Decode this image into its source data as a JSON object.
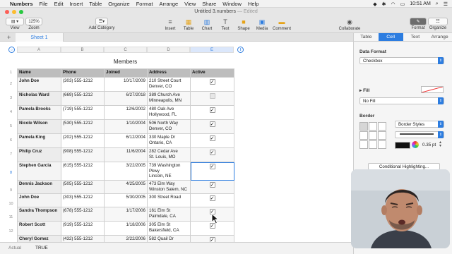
{
  "menubar": {
    "app_name": "Numbers",
    "items": [
      "File",
      "Edit",
      "Insert",
      "Table",
      "Organize",
      "Format",
      "Arrange",
      "View",
      "Share",
      "Window",
      "Help"
    ],
    "clock": "10:51 AM"
  },
  "window": {
    "title": "Untitled 3.numbers",
    "edited": "— Edited"
  },
  "toolbar": {
    "view": "View",
    "zoom_value": "125%",
    "zoom": "Zoom",
    "add_category": "Add Category",
    "insert": "Insert",
    "table": "Table",
    "chart": "Chart",
    "text": "Text",
    "shape": "Shape",
    "media": "Media",
    "comment": "Comment",
    "collaborate": "Collaborate",
    "format": "Format",
    "organize": "Organize"
  },
  "sheet": {
    "tab": "Sheet 1"
  },
  "columns": [
    "A",
    "B",
    "C",
    "D",
    "E"
  ],
  "table": {
    "title": "Members",
    "headers": [
      "Name",
      "Phone",
      "Joined",
      "Address",
      "Active"
    ],
    "rows": [
      {
        "name": "John Doe",
        "phone": "(303) 555-1212",
        "joined": "10/17/2009",
        "addr1": "210 Street Court",
        "addr2": "Denver, CO",
        "addr3": "",
        "active": true
      },
      {
        "name": "Nicholas Ward",
        "phone": "(669) 555-1212",
        "joined": "6/27/2018",
        "addr1": "389 Church Ave",
        "addr2": "Minneapolis, MN",
        "addr3": "",
        "active": false
      },
      {
        "name": "Pamela Brooks",
        "phone": "(719) 555-1212",
        "joined": "12/6/2002",
        "addr1": "480 Oak Ave",
        "addr2": "Hollywood, FL",
        "addr3": "",
        "active": true
      },
      {
        "name": "Nicole Wilson",
        "phone": "(530) 555-1212",
        "joined": "1/10/2004",
        "addr1": "506 North Way",
        "addr2": "Denver, CO",
        "addr3": "",
        "active": true
      },
      {
        "name": "Pamela King",
        "phone": "(202) 555-1212",
        "joined": "6/12/2004",
        "addr1": "330 Maple Dr",
        "addr2": "Ontario, CA",
        "addr3": "",
        "active": true
      },
      {
        "name": "Philip Cruz",
        "phone": "(908) 555-1212",
        "joined": "11/6/2004",
        "addr1": "282 Cedar Ave",
        "addr2": "St. Louis, MO",
        "addr3": "",
        "active": true
      },
      {
        "name": "Stephen Garcia",
        "phone": "(615) 555-1212",
        "joined": "3/22/2005",
        "addr1": "739 Washington",
        "addr2": "Pkwy",
        "addr3": "Lincoln, NE",
        "active": true
      },
      {
        "name": "Dennis Jackson",
        "phone": "(505) 555-1212",
        "joined": "4/25/2005",
        "addr1": "473 Elm Way",
        "addr2": "Winston Salem, NC",
        "addr3": "",
        "active": true
      },
      {
        "name": "John Doe",
        "phone": "(303) 555-1212",
        "joined": "5/30/2005",
        "addr1": "300 Street Road",
        "addr2": "",
        "addr3": "",
        "active": true
      },
      {
        "name": "Sandra Thompson",
        "phone": "(678) 555-1212",
        "joined": "1/17/2006",
        "addr1": "161 Elm St",
        "addr2": "Palmdale, CA",
        "addr3": "",
        "active": true
      },
      {
        "name": "Robert Scott",
        "phone": "(919) 555-1212",
        "joined": "1/18/2006",
        "addr1": "305 Elm St",
        "addr2": "Bakersfield, CA",
        "addr3": "",
        "active": true
      },
      {
        "name": "Cheryl Gomez",
        "phone": "(432) 555-1212",
        "joined": "2/22/2006",
        "addr1": "582 Quail Dr",
        "addr2": "",
        "addr3": "",
        "active": true
      }
    ]
  },
  "status": {
    "label": "Actual",
    "value": "TRUE"
  },
  "inspector": {
    "tabs": [
      "Table",
      "Cell",
      "Text",
      "Arrange"
    ],
    "data_format_label": "Data Format",
    "data_format_value": "Checkbox",
    "fill_label": "Fill",
    "fill_value": "No Fill",
    "border_label": "Border",
    "border_styles": "Border Styles",
    "border_width": "0.35 pt",
    "conditional_highlighting": "Conditional Highlighting..."
  }
}
